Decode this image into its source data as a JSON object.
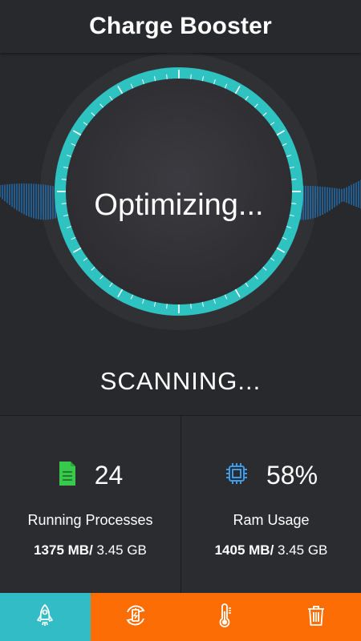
{
  "header": {
    "title": "Charge Booster"
  },
  "hero": {
    "center_text": "Optimizing...",
    "status_text": "SCANNING..."
  },
  "stats": {
    "processes": {
      "icon": "document-icon",
      "value": "24",
      "label": "Running Processes",
      "used": "1375 MB/",
      "total": " 3.45 GB"
    },
    "ram": {
      "icon": "cpu-chip-icon",
      "value": "58%",
      "label": "Ram Usage",
      "used": "1405 MB/",
      "total": " 3.45 GB"
    }
  },
  "nav": {
    "items": [
      {
        "icon": "rocket-icon",
        "active": true
      },
      {
        "icon": "battery-refresh-icon",
        "active": false
      },
      {
        "icon": "thermometer-icon",
        "active": false
      },
      {
        "icon": "trash-icon",
        "active": false
      }
    ]
  },
  "colors": {
    "ring": "#2ec2c0",
    "wave": "#1e8ce8",
    "nav_active": "#32bcc6",
    "nav_inactive": "#fd6d05",
    "document_icon": "#37c84c",
    "chip_icon": "#3d9be8"
  }
}
